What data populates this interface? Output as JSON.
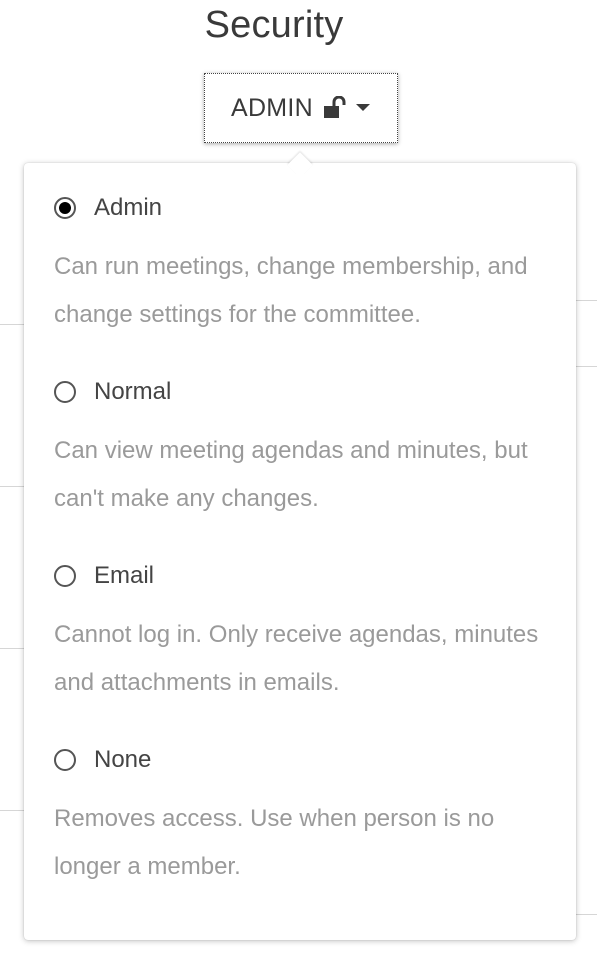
{
  "header": {
    "title": "Security"
  },
  "access_button": {
    "label": "ADMIN",
    "lock_icon": "unlocked-padlock-icon",
    "caret_icon": "caret-down-icon"
  },
  "options": [
    {
      "label": "Admin",
      "description": "Can run meetings, change membership, and change settings for the committee.",
      "selected": true
    },
    {
      "label": "Normal",
      "description": "Can view meeting agendas and minutes, but can't make any changes.",
      "selected": false
    },
    {
      "label": "Email",
      "description": "Cannot log in. Only receive agendas, minutes and attachments in emails.",
      "selected": false
    },
    {
      "label": "None",
      "description": "Removes access. Use when person is no longer a member.",
      "selected": false
    }
  ],
  "colors": {
    "radio_border": "#555555",
    "radio_dot": "#000000",
    "description_text": "#9a9a9a"
  }
}
